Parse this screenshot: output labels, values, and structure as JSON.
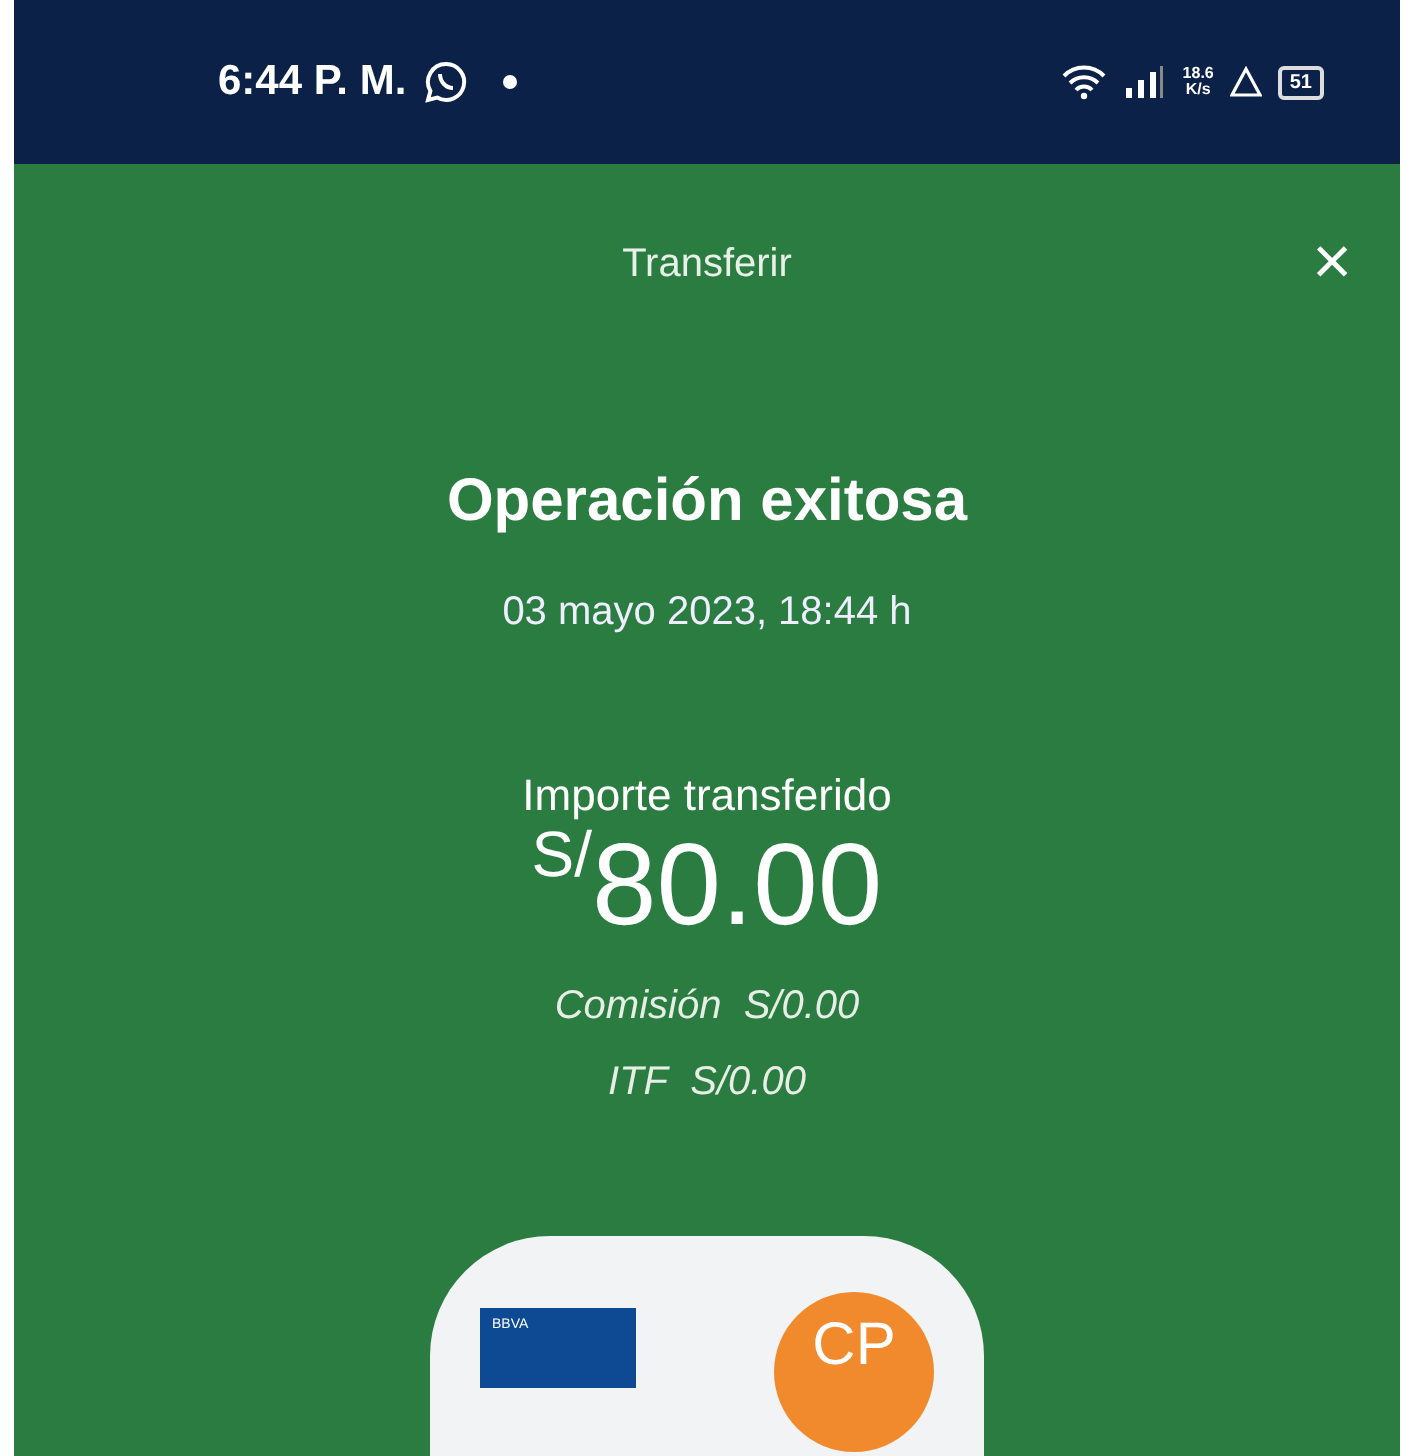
{
  "status_bar": {
    "time": "6:44 P. M.",
    "net_speed": "18.6",
    "net_unit": "K/s",
    "battery": "51"
  },
  "header": {
    "title": "Transferir",
    "close": "×"
  },
  "result": {
    "title": "Operación exitosa",
    "date": "03 mayo 2023, 18:44 h",
    "amount_label": "Importe transferido",
    "amount": "$^{S/}$80.00",
    "fees": [
      {
        "label": "Comisión",
        "value": "S/0.00"
      },
      {
        "label": "ITF",
        "value": "S/0.00"
      }
    ]
  },
  "transfer_card": {
    "bank_logo": "BBVA",
    "recipient_initials": "CP"
  }
}
